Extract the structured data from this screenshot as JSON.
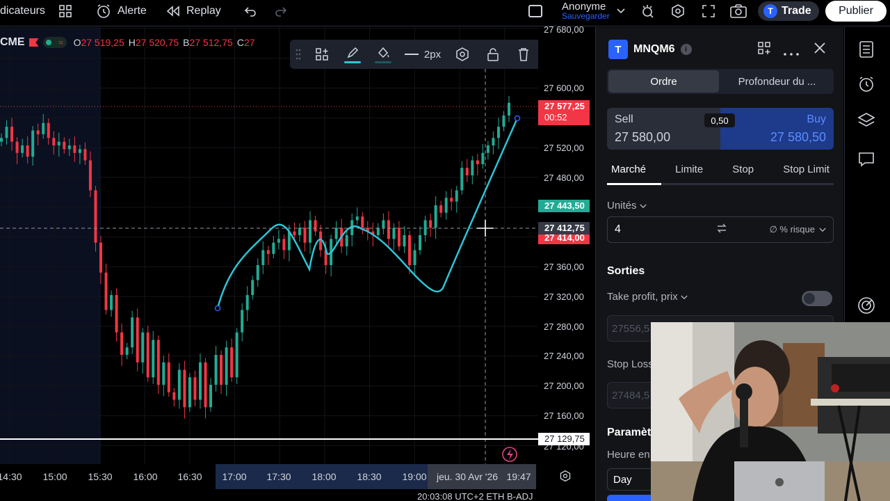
{
  "topbar": {
    "indicators": "dicateurs",
    "alert": "Alerte",
    "replay": "Replay",
    "account_name": "Anonyme",
    "account_sub": "Sauvegarder",
    "trade": "Trade",
    "publish": "Publier"
  },
  "legend": {
    "exchange": "CME",
    "o_label": "O",
    "o_value": "27 519,25",
    "h_label": "H",
    "h_value": "27 520,75",
    "b_label": "B",
    "b_value": "27 512,75",
    "c_label": "C",
    "c_value": "27"
  },
  "drawbar": {
    "width_label": "2px"
  },
  "price_axis": {
    "ticks": [
      "27 680,00",
      "27 600,00",
      "27 520,00",
      "27 480,00",
      "27 360,00",
      "27 320,00",
      "27 280,00",
      "27 240,00",
      "27 200,00",
      "27 160,00",
      "27 120,00"
    ],
    "last_price": "27 577,25",
    "countdown": "00:52",
    "green_label": "27 443,50",
    "crosshair_label": "27 412,75",
    "red_label": "27 414,00",
    "white_line_label": "27 129,75"
  },
  "time_axis": {
    "ticks": [
      "14:30",
      "15:00",
      "15:30",
      "16:00",
      "16:30",
      "17:00",
      "17:30",
      "18:00",
      "18:30",
      "19:00",
      "jeu. 30 Avr '26",
      "19:47"
    ],
    "status": "20:03:08 UTC+2   ETH        B-ADJ"
  },
  "panel": {
    "symbol": "MNQM6",
    "logo_letter": "T",
    "tabs": [
      "Ordre",
      "Profondeur du ..."
    ],
    "sell_label": "Sell",
    "sell_price": "27 580,00",
    "buy_label": "Buy",
    "buy_price": "27 580,50",
    "spread": "0,50",
    "order_types": [
      "Marché",
      "Limite",
      "Stop",
      "Stop Limit"
    ],
    "units_label": "Unités",
    "units_value": "4",
    "risk_label": "∅ % risque",
    "exits": "Sorties",
    "tp_label": "Take profit, prix",
    "tp_placeholder": "27556,5",
    "sl_label": "Stop Loss",
    "sl_placeholder": "27484,5",
    "params": "Paramètr",
    "heure": "Heure en",
    "day": "Day"
  },
  "chart_data": {
    "type": "candlestick",
    "symbol": "MNQM6",
    "exchange": "CME",
    "ohlc_shown": {
      "open": 27519.25,
      "high": 27520.75,
      "low": 27512.75
    },
    "ylim": [
      27120,
      27680
    ],
    "x_ticks": [
      "14:30",
      "15:00",
      "15:30",
      "16:00",
      "16:30",
      "17:00",
      "17:30",
      "18:00",
      "18:30",
      "19:00",
      "jeu. 30 Avr '26",
      "19:47"
    ],
    "closes": [
      27530,
      27545,
      27525,
      27510,
      27520,
      27505,
      27540,
      27535,
      27550,
      27530,
      27520,
      27525,
      27515,
      27520,
      27510,
      27515,
      27500,
      27460,
      27390,
      27350,
      27300,
      27320,
      27270,
      27240,
      27250,
      27290,
      27230,
      27270,
      27210,
      27260,
      27200,
      27230,
      27190,
      27180,
      27220,
      27170,
      27210,
      27180,
      27230,
      27170,
      27200,
      27240,
      27200,
      27250,
      27210,
      27270,
      27300,
      27320,
      27340,
      27360,
      27380,
      27375,
      27390,
      27395,
      27380,
      27405,
      27400,
      27410,
      27390,
      27420,
      27405,
      27380,
      27360,
      27395,
      27410,
      27385,
      27400,
      27420,
      27425,
      27410,
      27405,
      27400,
      27410,
      27420,
      27395,
      27410,
      27385,
      27400,
      27360,
      27380,
      27400,
      27420,
      27410,
      27440,
      27430,
      27450,
      27445,
      27460,
      27490,
      27480,
      27500,
      27495,
      27510,
      27520,
      27530,
      27545,
      27560,
      27577
    ]
  },
  "colors": {
    "up": "#22ab94",
    "down": "#f23645",
    "drawing": "#2ec4d6",
    "accent": "#2962ff"
  }
}
